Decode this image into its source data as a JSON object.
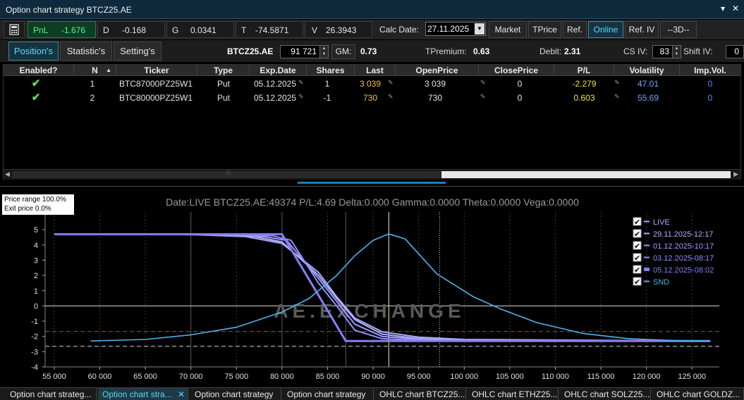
{
  "window": {
    "title": "Option chart strategy BTCZ25.AE",
    "pin": "▾",
    "close": "✕"
  },
  "toolbar": {
    "pnl_label": "PnL",
    "pnl_value": "-1.676",
    "d_label": "D",
    "d_value": "-0.168",
    "g_label": "G",
    "g_value": "0.0341",
    "t_label": "T",
    "t_value": "-74.5871",
    "v_label": "V",
    "v_value": "26.3943",
    "calc_date_label": "Calc Date:",
    "calc_date_value": "27.11.2025",
    "buttons": [
      "Market",
      "TPrice",
      "Ref.",
      "Online",
      "Ref. IV",
      "--3D--"
    ]
  },
  "tabs": [
    "Position's",
    "Statistic's",
    "Setting's"
  ],
  "summary": {
    "symbol": "BTCZ25.AE",
    "price": "91 721",
    "gm_label": "GM:",
    "gm_value": "0.73",
    "tpremium_label": "TPremium:",
    "tpremium_value": "0.63",
    "debit_label": "Debit:",
    "debit_value": "2.31",
    "csiv_label": "CS IV:",
    "csiv_value": "83",
    "shiftiv_label": "Shift IV:",
    "shiftiv_value": "0"
  },
  "table": {
    "headers": [
      "Enabled?",
      "N",
      "Ticker",
      "Type",
      "Exp.Date",
      "Shares",
      "Last",
      "OpenPrice",
      "ClosePrice",
      "P/L",
      "Volatility",
      "Imp.Vol."
    ],
    "rows": [
      {
        "enabled": "✔",
        "n": "1",
        "ticker": "BTC87000PZ25W1",
        "type": "Put",
        "exp": "05.12.2025",
        "shares": "1",
        "last": "3 039",
        "open": "3 039",
        "close": "0",
        "pl": "-2.279",
        "vol": "47.01",
        "imp": "0"
      },
      {
        "enabled": "✔",
        "n": "2",
        "ticker": "BTC80000PZ25W1",
        "type": "Put",
        "exp": "05.12.2025",
        "shares": "-1",
        "last": "730",
        "open": "730",
        "close": "0",
        "pl": "0.603",
        "vol": "55.69",
        "imp": "0"
      }
    ]
  },
  "chart_info": {
    "line1": "Price range 100.0%",
    "line2": "Exit price 0.0%"
  },
  "chart_data": {
    "type": "line",
    "title": "Date:LIVE  BTCZ25.AE:49374  P/L:4.69  Delta:0.000  Gamma:0.0000  Theta:0.0000  Vega:0.0000",
    "watermark": "AE.EXCHANGE",
    "xlim": [
      54000,
      128000
    ],
    "ylim": [
      -4,
      5.7
    ],
    "x_ticks": [
      55000,
      60000,
      65000,
      70000,
      75000,
      80000,
      85000,
      90000,
      95000,
      100000,
      105000,
      110000,
      115000,
      120000,
      125000
    ],
    "x_tick_labels": [
      "55 000",
      "60 000",
      "65 000",
      "70 000",
      "75 000",
      "80 000",
      "85 000",
      "90 000",
      "95 000",
      "100 000",
      "105 000",
      "110 000",
      "115 000",
      "120 000",
      "125 000"
    ],
    "y_ticks": [
      -4,
      -3,
      -2,
      -1,
      0,
      1,
      2,
      3,
      4,
      5
    ],
    "current_price": 91721,
    "reference_lines": [
      {
        "name": "red-dashed",
        "y": -1.68,
        "color": "#d23a3a"
      },
      {
        "name": "white-dashed",
        "y": -2.65,
        "color": "#cfcfcf"
      }
    ],
    "vertical_markers": [
      {
        "x": 91721,
        "color": "#f3eeb0",
        "style": "solid"
      },
      {
        "x": 97300,
        "color": "#e0e0e0",
        "style": "dotted"
      }
    ],
    "series": [
      {
        "name": "LIVE",
        "color": "#a9a9ff",
        "x": [
          55000,
          70000,
          76000,
          80000,
          84000,
          86000,
          88000,
          91000,
          95000,
          100000,
          127000
        ],
        "y": [
          4.7,
          4.68,
          4.55,
          4.1,
          2.2,
          0.6,
          -0.8,
          -1.7,
          -2.05,
          -2.2,
          -2.3
        ]
      },
      {
        "name": "29.11.2025-12:17",
        "color": "#b0b0ff",
        "x": [
          55000,
          72000,
          77000,
          80000,
          84000,
          86000,
          88000,
          91000,
          95000,
          100000,
          127000
        ],
        "y": [
          4.7,
          4.68,
          4.55,
          4.2,
          2.0,
          0.5,
          -0.9,
          -1.85,
          -2.15,
          -2.25,
          -2.3
        ]
      },
      {
        "name": "01.12.2025-10:17",
        "color": "#9d9dff",
        "x": [
          55000,
          74000,
          78000,
          80500,
          84000,
          86000,
          88000,
          91000,
          95000,
          100000,
          127000
        ],
        "y": [
          4.7,
          4.68,
          4.55,
          4.3,
          1.8,
          0.3,
          -1.2,
          -2.0,
          -2.2,
          -2.27,
          -2.3
        ]
      },
      {
        "name": "03.12.2025-08:17",
        "color": "#8f8fff",
        "x": [
          55000,
          76000,
          79000,
          81000,
          84000,
          86000,
          88000,
          91000,
          95000,
          127000
        ],
        "y": [
          4.7,
          4.68,
          4.6,
          4.3,
          1.5,
          0.0,
          -1.6,
          -2.15,
          -2.27,
          -2.3
        ]
      },
      {
        "name": "05.12.2025-08:02",
        "color": "#8a7cf0",
        "x": [
          55000,
          80000,
          87000,
          127000
        ],
        "y": [
          4.7,
          4.7,
          -2.3,
          -2.3
        ]
      },
      {
        "name": "SND",
        "color": "#4fb3ea",
        "x": [
          59000,
          65000,
          70000,
          75000,
          80000,
          83000,
          86000,
          88000,
          90000,
          91700,
          93500,
          97000,
          101000,
          104000,
          108000,
          113000,
          118000,
          123000,
          127000
        ],
        "y": [
          -2.3,
          -2.2,
          -1.9,
          -1.4,
          -0.4,
          0.5,
          2.0,
          3.3,
          4.3,
          4.72,
          4.4,
          2.1,
          0.6,
          -0.2,
          -1.1,
          -1.8,
          -2.15,
          -2.27,
          -2.3
        ]
      }
    ],
    "legend": {
      "placement": "top-right",
      "items": [
        "LIVE",
        "29.11.2025-12:17",
        "01.12.2025-10:17",
        "03.12.2025-08:17",
        "05.12.2025-08:02",
        "SND"
      ]
    }
  },
  "bottom_tabs": [
    "Option chart strateg...",
    "Option chart stra...",
    "Option chart strategy",
    "Option chart strategy",
    "OHLC chart BTCZ25...",
    "OHLC chart ETHZ25...",
    "OHLC chart SOLZ25...",
    "OHLC chart GOLDZ..."
  ],
  "colors": {
    "accent": "#5ad6ff",
    "last_price": "#f3c13a",
    "pl_negative": "#f3e23a",
    "pl_positive": "#f3e23a",
    "volatility": "#6aa9ff",
    "imp_vol": "#4e8dff"
  }
}
